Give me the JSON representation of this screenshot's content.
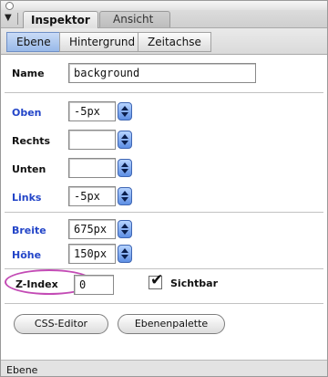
{
  "tabs_top": {
    "active": "Inspektor",
    "inactive": "Ansicht"
  },
  "tabs_sub": [
    "Ebene",
    "Hintergrund",
    "Zeitachse"
  ],
  "name": {
    "label": "Name",
    "value": "background"
  },
  "position": [
    {
      "label": "Oben",
      "value": "-5px",
      "color": "#2345c8"
    },
    {
      "label": "Rechts",
      "value": "",
      "color": "#111111"
    },
    {
      "label": "Unten",
      "value": "",
      "color": "#111111"
    },
    {
      "label": "Links",
      "value": "-5px",
      "color": "#2345c8"
    }
  ],
  "size": [
    {
      "label": "Breite",
      "value": "675px",
      "color": "#2345c8"
    },
    {
      "label": "Höhe",
      "value": "150px",
      "color": "#2345c8"
    }
  ],
  "zindex": {
    "label": "Z-Index",
    "value": "0",
    "highlight_color": "#c34bb5"
  },
  "sichtbar": {
    "label": "Sichtbar",
    "checked": true,
    "check_glyph": "✔"
  },
  "buttons": {
    "css_editor": "CSS-Editor",
    "ebenenpalette": "Ebenenpalette"
  },
  "status": "Ebene",
  "icons": {
    "collapse": "▼",
    "window": "circle-icon"
  }
}
